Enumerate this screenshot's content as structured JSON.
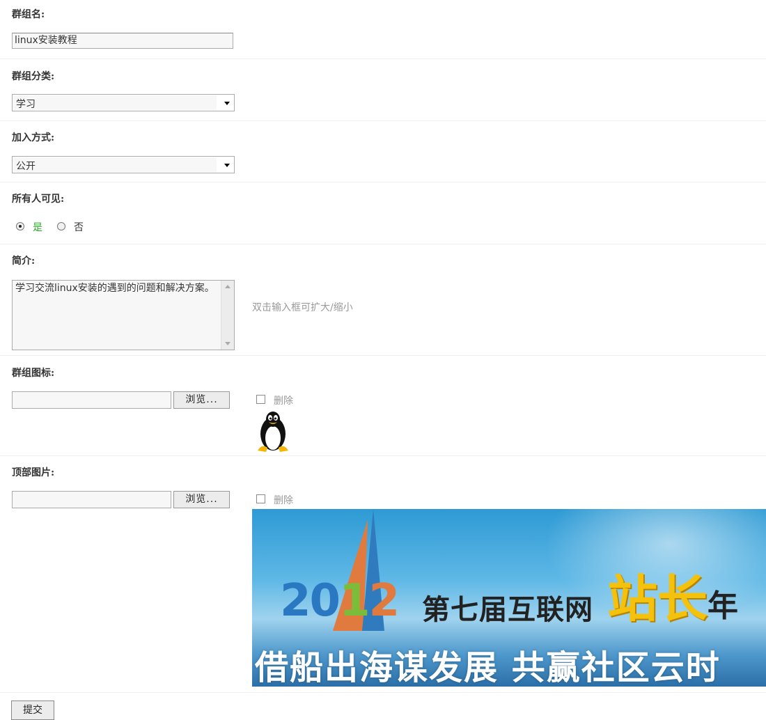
{
  "group_name": {
    "label": "群组名:",
    "value": "linux安装教程"
  },
  "category": {
    "label": "群组分类:",
    "selected": "学习"
  },
  "join_mode": {
    "label": "加入方式:",
    "selected": "公开"
  },
  "visibility": {
    "label": "所有人可见:",
    "options": [
      {
        "label": "是",
        "checked": true
      },
      {
        "label": "否",
        "checked": false
      }
    ]
  },
  "intro": {
    "label": "简介:",
    "value": "学习交流linux安装的遇到的问题和解决方案。",
    "hint": "双击输入框可扩大/缩小"
  },
  "group_icon": {
    "label": "群组图标:",
    "browse_label": "浏览...",
    "delete_label": "删除"
  },
  "header_image": {
    "label": "顶部图片:",
    "browse_label": "浏览...",
    "delete_label": "删除",
    "banner": {
      "year": [
        "20",
        "1",
        "2"
      ],
      "line1": "第七届互联网",
      "line2": "站长",
      "line2_tail": "年",
      "line3": "借船出海谋发展 共赢社区云时"
    }
  },
  "submit_label": "提交",
  "colors": {
    "radio_yes": "#2aa82a",
    "hint": "#999999"
  }
}
